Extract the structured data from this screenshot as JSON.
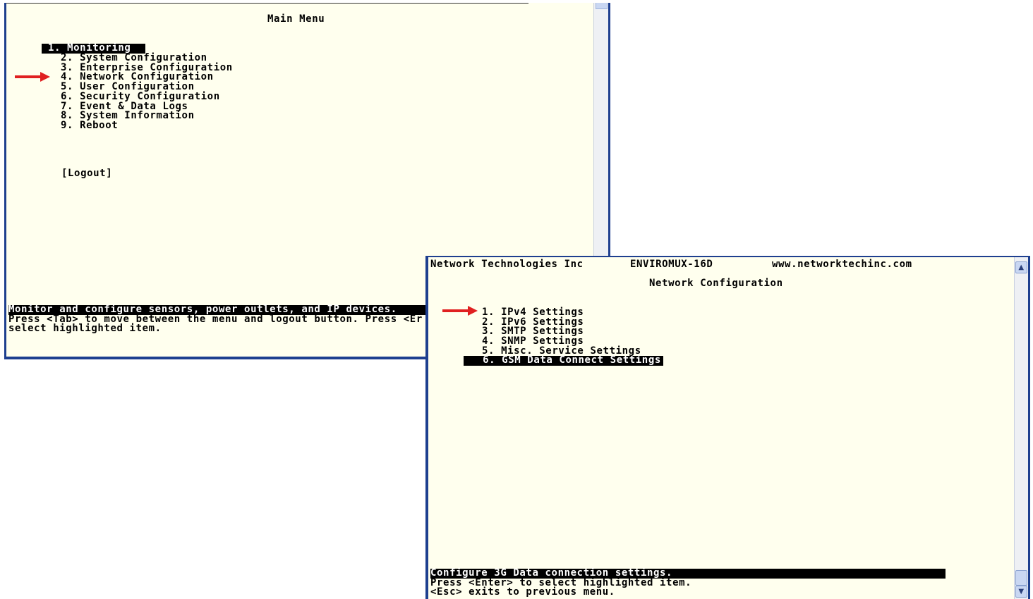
{
  "main_window": {
    "title": "Main Menu",
    "menu_items": [
      {
        "label": " 1. Monitoring"
      },
      {
        "label": "2. System Configuration"
      },
      {
        "label": "3. Enterprise Configuration"
      },
      {
        "label": "4. Network Configuration"
      },
      {
        "label": "5. User Configuration"
      },
      {
        "label": "6. Security Configuration"
      },
      {
        "label": "7. Event & Data Logs"
      },
      {
        "label": "8. System Information"
      },
      {
        "label": "9. Reboot"
      }
    ],
    "logout_label": "[Logout]",
    "status_lines": [
      "Monitor and configure sensors, power outlets, and IP devices.",
      "Press <Tab> to move between the menu and logout button. Press <Er",
      "select highlighted item."
    ]
  },
  "network_window": {
    "header_company": "Network Technologies Inc",
    "header_product": "ENVIROMUX-16D",
    "header_website": "www.networktechinc.com",
    "title": "Network Configuration",
    "menu_items": [
      {
        "label": "1. IPv4 Settings"
      },
      {
        "label": "2. IPv6 Settings"
      },
      {
        "label": "3. SMTP Settings"
      },
      {
        "label": "4. SNMP Settings"
      },
      {
        "label": "5. Misc. Service Settings"
      },
      {
        "label": "   6. GSM Data Connect Settings"
      }
    ],
    "status_lines": [
      "Configure 3G Data connection settings.",
      "Press <Enter> to select highlighted item.",
      "<Esc> exits to previous menu."
    ]
  },
  "colors": {
    "terminal_bg": "#ffffee",
    "window_border": "#1e3f8f",
    "annotation_arrow": "#e02020"
  }
}
